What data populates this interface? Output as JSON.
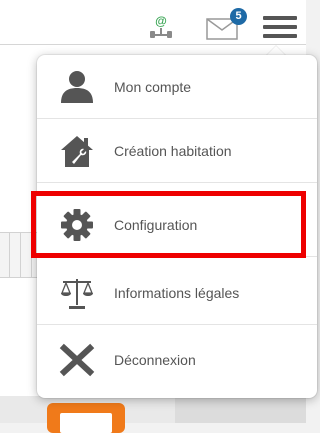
{
  "header": {
    "network_icon": "network-at-icon",
    "network_symbol": "@",
    "mail_icon": "envelope-icon",
    "mail_badge_count": "5",
    "menu_icon": "hamburger-icon"
  },
  "menu": {
    "items": [
      {
        "label": "Mon compte",
        "icon": "user-icon"
      },
      {
        "label": "Création habitation",
        "icon": "house-wrench-icon"
      },
      {
        "label": "Configuration",
        "icon": "gear-icon"
      },
      {
        "label": "Informations légales",
        "icon": "scales-icon"
      },
      {
        "label": "Déconnexion",
        "icon": "close-x-icon"
      }
    ],
    "highlighted_item": "Configuration"
  },
  "colors": {
    "highlight_border": "#ee0000",
    "badge_blue": "#1e6aa6",
    "network_green": "#3aa655",
    "icon_gray": "#555555",
    "orange_button": "#f07a1a"
  }
}
